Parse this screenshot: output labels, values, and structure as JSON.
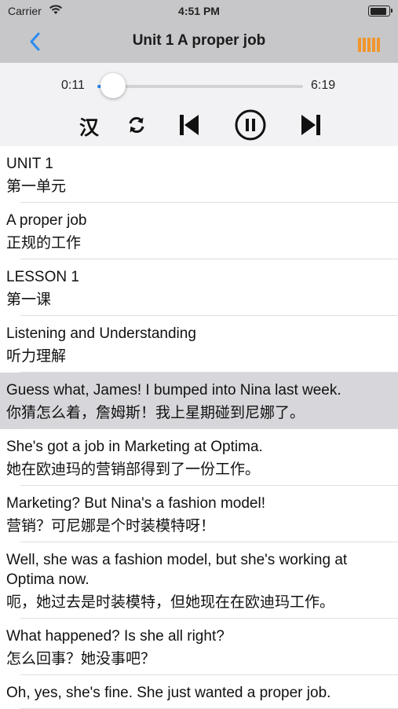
{
  "status_bar": {
    "carrier": "Carrier",
    "time": "4:51 PM"
  },
  "nav": {
    "title": "Unit 1  A proper job",
    "back_icon": "chevron-left-icon",
    "menu_icon": "bars-icon",
    "accent": "#f0962c",
    "back_color": "#2b8cf0"
  },
  "player": {
    "current_time": "0:11",
    "total_time": "6:19",
    "progress": 0.03,
    "han_label": "汉"
  },
  "lines": [
    {
      "en": "UNIT 1",
      "zh": "第一单元",
      "highlighted": false
    },
    {
      "en": "A proper job",
      "zh": "正规的工作",
      "highlighted": false
    },
    {
      "en": "LESSON 1",
      "zh": "第一课",
      "highlighted": false
    },
    {
      "en": "Listening and Understanding",
      "zh": "听力理解",
      "highlighted": false
    },
    {
      "en": "Guess what, James! I bumped into Nina last week.",
      "zh": "你猜怎么着，詹姆斯！我上星期碰到尼娜了。",
      "highlighted": true
    },
    {
      "en": "She's got a job in Marketing at Optima.",
      "zh": "她在欧迪玛的营销部得到了一份工作。",
      "highlighted": false
    },
    {
      "en": "Marketing? But Nina's a fashion model!",
      "zh": "营销？可尼娜是个时装模特呀！",
      "highlighted": false
    },
    {
      "en": "Well, she was a fashion model, but she's working at Optima now.",
      "zh": "呃，她过去是时装模特，但她现在在欧迪玛工作。",
      "highlighted": false
    },
    {
      "en": "What happened? Is she all right?",
      "zh": "怎么回事？她没事吧？",
      "highlighted": false
    },
    {
      "en": "Oh, yes, she's fine. She just wanted a proper job.",
      "zh": "",
      "highlighted": false
    }
  ]
}
